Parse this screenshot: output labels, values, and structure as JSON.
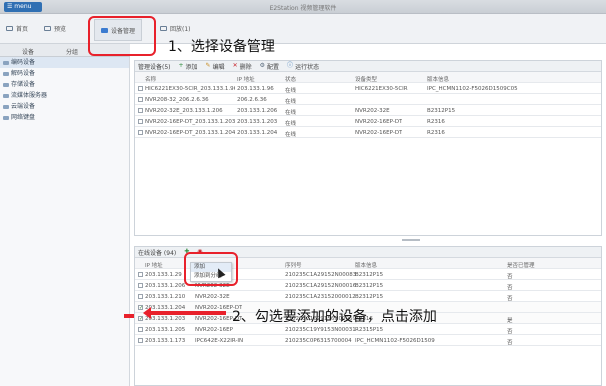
{
  "app": {
    "menu_label": "menu",
    "title": "E2Station 视频管理软件"
  },
  "tabs": [
    {
      "label": "首页",
      "icon": "grid-icon"
    },
    {
      "label": "预览",
      "icon": "monitor-icon"
    },
    {
      "label": "设备管理",
      "icon": "camera-icon"
    },
    {
      "label": "回放(1)",
      "icon": "playback-icon"
    }
  ],
  "subtabs": [
    "设备",
    "分组"
  ],
  "sidebar": [
    {
      "label": "编码设备"
    },
    {
      "label": "解码设备"
    },
    {
      "label": "存储设备"
    },
    {
      "label": "流媒体服务器"
    },
    {
      "label": "云端设备"
    },
    {
      "label": "网络键盘"
    }
  ],
  "managed": {
    "toolbar": [
      {
        "label": "管理设备(5)",
        "icon": ""
      },
      {
        "label": "添加",
        "icon": "plus-icon"
      },
      {
        "label": "编辑",
        "icon": "pencil-icon"
      },
      {
        "label": "删除",
        "icon": "close-icon"
      },
      {
        "label": "配置",
        "icon": "gear-icon"
      },
      {
        "label": "运行状态",
        "icon": "info-icon"
      }
    ],
    "columns": [
      "名称",
      "IP 地址",
      "状态",
      "设备类型",
      "版本信息"
    ],
    "rows": [
      [
        "HIC6221EX30-5CIR_203.133.1.96",
        "203.133.1.96",
        "在线",
        "HIC6221EX30-5CIR",
        "IPC_HCMN1102-F5026D1509C05"
      ],
      [
        "NVR208-32_206.2.6.36",
        "206.2.6.36",
        "在线",
        "",
        ""
      ],
      [
        "NVR202-32E_203.133.1.206",
        "203.133.1.206",
        "在线",
        "NVR202-32E",
        "B2312P15"
      ],
      [
        "NVR202-16EP-DT_203.133.1.203",
        "203.133.1.203",
        "在线",
        "NVR202-16EP-DT",
        "R2316"
      ],
      [
        "NVR202-16EP-DT_203.133.1.204",
        "203.133.1.204",
        "在线",
        "NVR202-16EP-DT",
        "R2316"
      ]
    ]
  },
  "online": {
    "toolbar_label": "在线设备 (94)",
    "columns": [
      "IP 地址",
      "",
      "序列号",
      "版本信息",
      "",
      "是否已管理"
    ],
    "context_menu": [
      "添加",
      "添加到分组"
    ],
    "rows": [
      {
        "checked": false,
        "cells": [
          "203.133.1.29",
          "",
          "210235C1A29152N00083",
          "B2312P15",
          "",
          "否"
        ]
      },
      {
        "checked": false,
        "cells": [
          "203.133.1.206",
          "NVR202-32E",
          "210235C1A29152N00016",
          "B2312P15",
          "",
          "否"
        ]
      },
      {
        "checked": false,
        "cells": [
          "203.133.1.210",
          "NVR202-32E",
          "210235C1A23152000012",
          "B2312P15",
          "",
          "否"
        ]
      },
      {
        "checked": true,
        "cells": [
          "203.133.1.204",
          "NVR202-16EP-DT",
          "",
          "",
          "",
          ""
        ]
      },
      {
        "checked": true,
        "cells": [
          "203.133.1.203",
          "NVR202-16EP-DT",
          "210235C1629156N00069",
          "R2316",
          "",
          "是"
        ]
      },
      {
        "checked": false,
        "cells": [
          "203.133.1.205",
          "NVR202-16EP",
          "210235C19Y9153N00031",
          "R2315P15",
          "",
          "否"
        ]
      },
      {
        "checked": false,
        "cells": [
          "203.133.1.173",
          "IPC642E-X22IR-IN",
          "210235C0P6315700004",
          "IPC_HCMN1102-F5026D1509",
          "",
          "否"
        ]
      }
    ]
  },
  "annotations": {
    "step1": "1、选择设备管理",
    "step2": "2、勾选要添加的设备，点击添加"
  },
  "colors": {
    "highlight": "#e8212b",
    "accent": "#3b7bd0"
  }
}
